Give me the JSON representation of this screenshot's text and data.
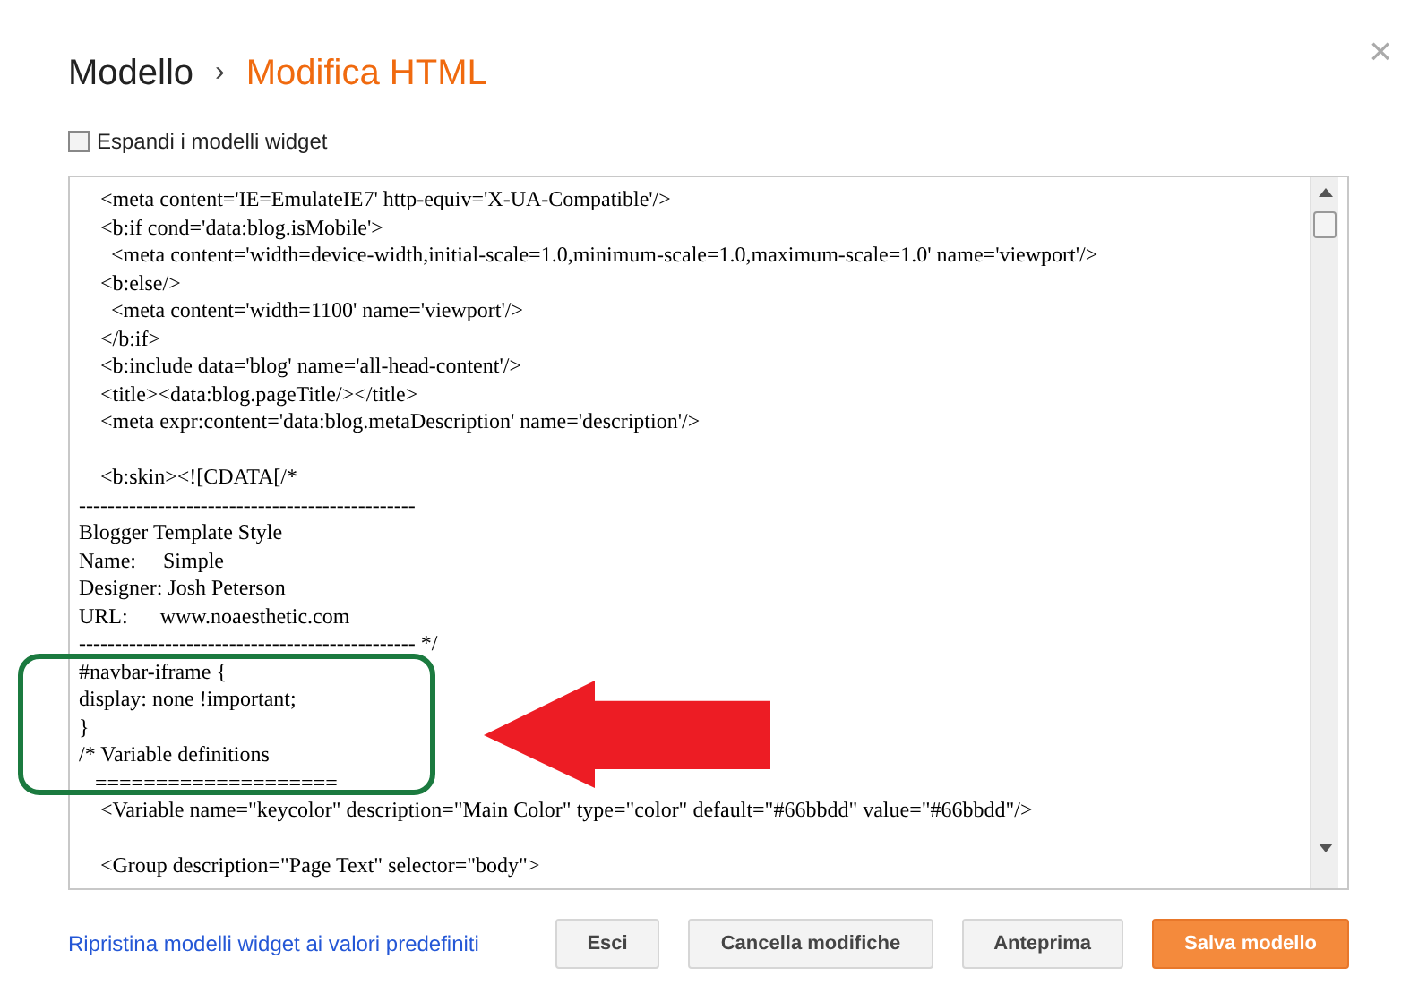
{
  "breadcrumb": {
    "parent": "Modello",
    "separator": "›",
    "current": "Modifica HTML"
  },
  "close_glyph": "×",
  "expand_widgets": {
    "label": "Espandi i modelli widget",
    "checked": false
  },
  "editor": {
    "blocks": [
      [
        "    <meta content='IE=EmulateIE7' http-equiv='X-UA-Compatible'/>",
        "    <b:if cond='data:blog.isMobile'>",
        "      <meta content='width=device-width,initial-scale=1.0,minimum-scale=1.0,maximum-scale=1.0' name='viewport'/>",
        "    <b:else/>",
        "      <meta content='width=1100' name='viewport'/>",
        "    </b:if>",
        "    <b:include data='blog' name='all-head-content'/>",
        "    <title><data:blog.pageTitle/></title>",
        "    <meta expr:content='data:blog.metaDescription' name='description'/>"
      ],
      [
        "    <b:skin><![CDATA[/*",
        "-----------------------------------------------",
        "Blogger Template Style",
        "Name:     Simple",
        "Designer: Josh Peterson",
        "URL:      www.noaesthetic.com",
        "----------------------------------------------- */",
        "#navbar-iframe {",
        "display: none !important;",
        "}",
        "/* Variable definitions",
        "   ====================",
        "    <Variable name=\"keycolor\" description=\"Main Color\" type=\"color\" default=\"#66bbdd\" value=\"#66bbdd\"/>"
      ],
      [
        "    <Group description=\"Page Text\" selector=\"body\">"
      ]
    ]
  },
  "footer": {
    "reset_link": "Ripristina modelli widget ai valori predefiniti",
    "buttons": [
      {
        "label": "Esci",
        "kind": "secondary"
      },
      {
        "label": "Cancella modifiche",
        "kind": "secondary"
      },
      {
        "label": "Anteprima",
        "kind": "secondary"
      },
      {
        "label": "Salva modello",
        "kind": "primary"
      }
    ]
  }
}
